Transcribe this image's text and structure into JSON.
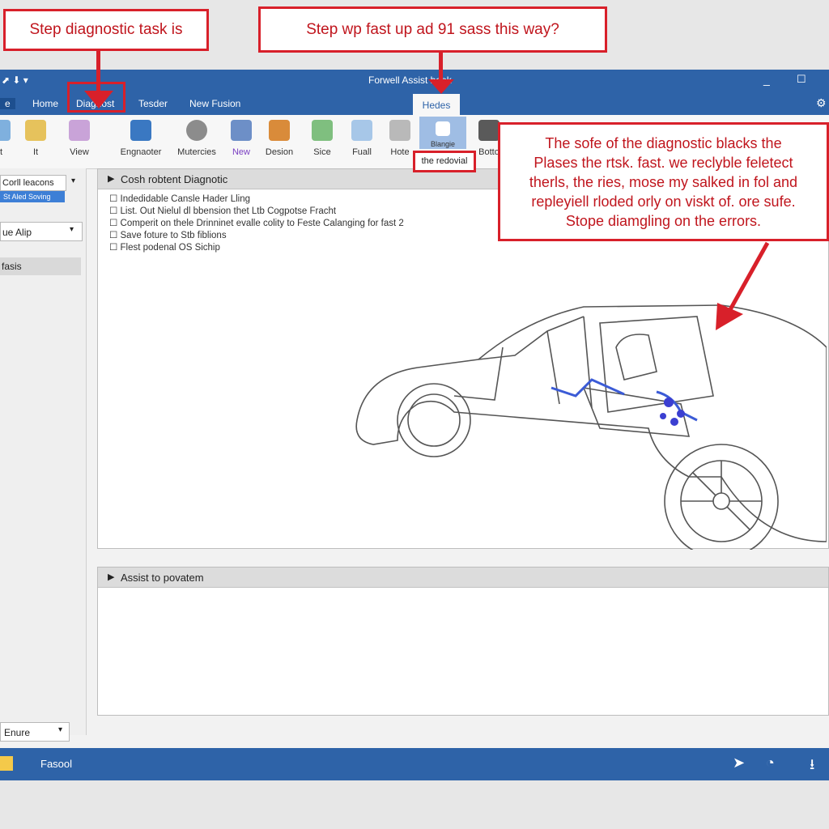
{
  "annotations": {
    "top_left": "Step diagnostic task is",
    "top_center": "Step wp fast up ad 91 sass this way?",
    "right_box": [
      "The sofe of the diagnostic blacks the",
      "Plases the rtsk. fast. we reclyble feletect",
      "therls, the ries, mose my salked in fol and",
      "repleyiell rloded orly on viskt of. ore sufe.",
      "Stope diamgling on the errors."
    ]
  },
  "window": {
    "title": "Forwell Assist book",
    "controls": {
      "min": "_",
      "max": "☐"
    }
  },
  "menubar": {
    "items": [
      "e",
      "Home",
      "Diagnost",
      "Tesder",
      "New Fusion",
      "Hedes"
    ]
  },
  "ribbon": {
    "buttons": [
      "It",
      "It",
      "View",
      "Engnaoter",
      "Mutercies",
      "New",
      "Desion",
      "Sice",
      "Fuall",
      "Hote",
      "Blangie",
      "Botto"
    ],
    "highlight_label": "the redovial"
  },
  "sidebar": {
    "field1": "Corll leacons",
    "field1_sub": "St Aled Soving",
    "select1": "ue Alip",
    "section": "fasis",
    "select_bottom": "Enure"
  },
  "main_panel": {
    "header": "Cosh robtent Diagnotic",
    "lines": [
      "Indedidable Cansle Hader Lling",
      "List. Out Nielul dl bbension thet Ltb Cogpotse Fracht",
      "Comperit on thele Drinninet evalle colity to Feste Calanging for fast 2",
      "Save foture to Stb fiblions",
      "Flest podenal OS Sichip"
    ]
  },
  "bottom_panel": {
    "header": "Assist to povatem"
  },
  "statusbar": {
    "label": "Fasool"
  },
  "colors": {
    "accent": "#2e63a8",
    "annotation": "#d8202a"
  }
}
